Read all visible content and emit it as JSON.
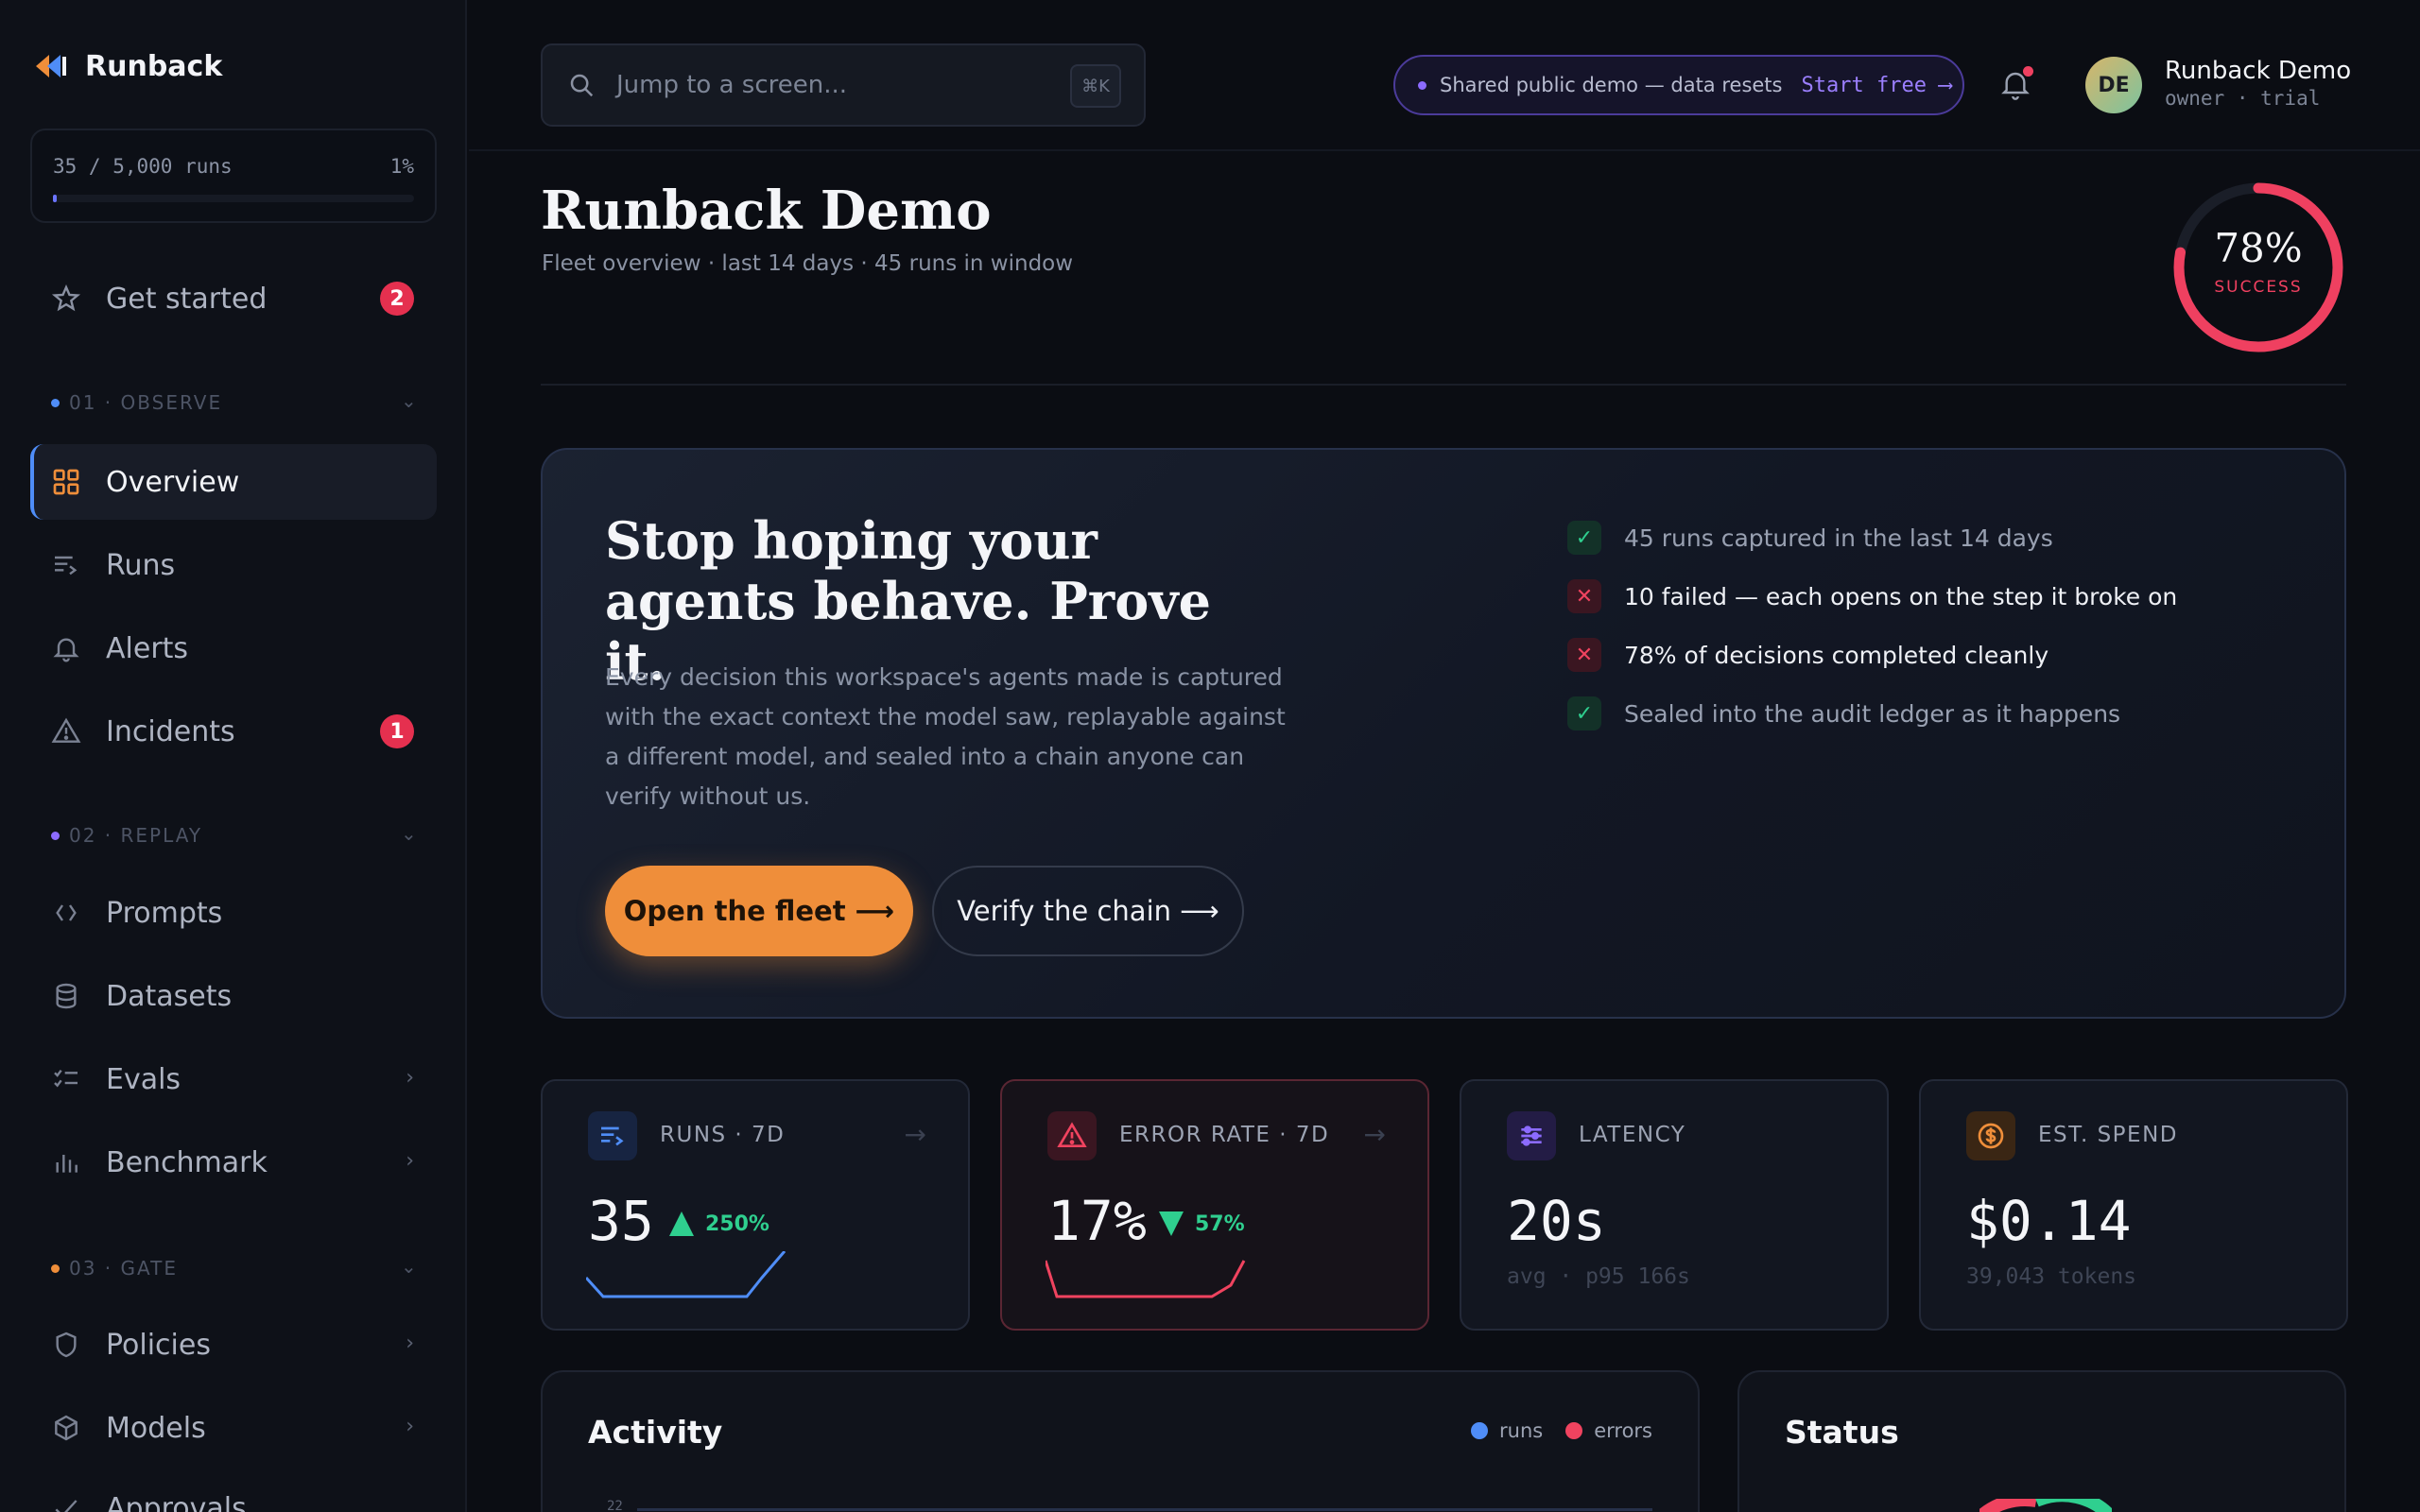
{
  "brand": {
    "name": "Runback"
  },
  "usage": {
    "runs": "35 / 5,000 runs",
    "percent": "1%",
    "fill_fraction": 0.01
  },
  "nav": {
    "get_started": {
      "label": "Get started",
      "badge": "2"
    },
    "sections": [
      {
        "label": "01 · OBSERVE",
        "color": "#4f8df7"
      },
      {
        "label": "02 · REPLAY",
        "color": "#8c6bff"
      },
      {
        "label": "03 · GATE",
        "color": "#ef8e3a"
      }
    ],
    "items": [
      {
        "label": "Overview",
        "icon": "grid-icon"
      },
      {
        "label": "Runs",
        "icon": "runs-list-icon"
      },
      {
        "label": "Alerts",
        "icon": "bell-icon"
      },
      {
        "label": "Incidents",
        "icon": "warning-triangle-icon",
        "badge": "1"
      },
      {
        "label": "Prompts",
        "icon": "code-brackets-icon"
      },
      {
        "label": "Datasets",
        "icon": "database-icon"
      },
      {
        "label": "Evals",
        "icon": "checklist-icon"
      },
      {
        "label": "Benchmark",
        "icon": "bar-chart-icon"
      },
      {
        "label": "Policies",
        "icon": "shield-icon"
      },
      {
        "label": "Models",
        "icon": "cube-icon"
      },
      {
        "label": "Approvals",
        "icon": "check-icon"
      }
    ]
  },
  "topbar": {
    "search_placeholder": "Jump to a screen...",
    "shortcut": "⌘K",
    "demo_text": "Shared public demo — data resets",
    "demo_cta": "Start free ⟶",
    "user_initials": "DE",
    "user_name": "Runback Demo",
    "user_role": "owner · trial"
  },
  "header": {
    "title": "Runback Demo",
    "subtitle": "Fleet overview · last 14 days · 45 runs in window",
    "success_value": "78%",
    "success_label": "SUCCESS",
    "success_fraction": 0.78
  },
  "hero": {
    "title_line1": "Stop hoping your",
    "title_line2": "agents behave. Prove it.",
    "body": "Every decision this workspace's agents made is captured with the exact context the model saw, replayable against a different model, and sealed into a chain anyone can verify without us.",
    "primary_button": "Open the fleet ⟶",
    "secondary_button": "Verify the chain ⟶",
    "checks": [
      {
        "text": "45 runs captured in the last 14 days",
        "status": "ok"
      },
      {
        "text": "10 failed — each opens on the step it broke on",
        "status": "bad"
      },
      {
        "text": "78% of decisions completed cleanly",
        "status": "bad"
      },
      {
        "text": "Sealed into the audit ledger as it happens",
        "status": "ok"
      }
    ]
  },
  "stats": [
    {
      "label": "RUNS · 7D",
      "value": "35",
      "delta": "250%",
      "direction": "up",
      "color": "#4f8df7",
      "arrow": "→"
    },
    {
      "label": "ERROR RATE · 7D",
      "value": "17%",
      "delta": "57%",
      "direction": "down",
      "color": "#f0435f",
      "arrow": "→"
    },
    {
      "label": "LATENCY",
      "value": "20s",
      "sub": "avg · p95 166s",
      "color": "#8c6bff"
    },
    {
      "label": "EST. SPEND",
      "value": "$0.14",
      "sub": "39,043 tokens",
      "color": "#ef8e3a"
    }
  ],
  "activity": {
    "title": "Activity",
    "legend": [
      "runs",
      "errors"
    ],
    "legend_colors": [
      "#4f8df7",
      "#f0435f"
    ],
    "y_tick": "22"
  },
  "status": {
    "title": "Status"
  }
}
